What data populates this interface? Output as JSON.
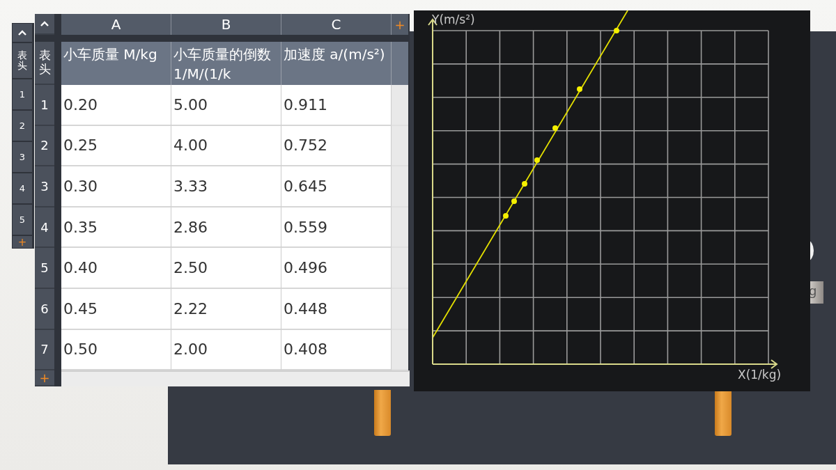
{
  "back_sheet": {
    "header_label": "表头",
    "row_numbers": [
      "1",
      "2",
      "3",
      "4",
      "5"
    ],
    "add_row": "+"
  },
  "sheet": {
    "columns": [
      "A",
      "B",
      "C"
    ],
    "add_column": "+",
    "header_label": "表头",
    "headers": [
      "小车质量 M/kg",
      "小车质量的倒数 1/M/(1/k",
      "加速度 a/(m/s²)"
    ],
    "rows": [
      {
        "number": "1",
        "cells": [
          "0.20",
          "5.00",
          "0.911"
        ]
      },
      {
        "number": "2",
        "cells": [
          "0.25",
          "4.00",
          "0.752"
        ]
      },
      {
        "number": "3",
        "cells": [
          "0.30",
          "3.33",
          "0.645"
        ]
      },
      {
        "number": "4",
        "cells": [
          "0.35",
          "2.86",
          "0.559"
        ]
      },
      {
        "number": "5",
        "cells": [
          "0.40",
          "2.50",
          "0.496"
        ]
      },
      {
        "number": "6",
        "cells": [
          "0.45",
          "2.22",
          "0.448"
        ]
      },
      {
        "number": "7",
        "cells": [
          "0.50",
          "2.00",
          "0.408"
        ]
      }
    ],
    "add_row": "+"
  },
  "graph": {
    "y_axis_label": "Y(m/s²)",
    "x_axis_label": "X(1/kg)"
  },
  "scene": {
    "tag": "g"
  }
}
